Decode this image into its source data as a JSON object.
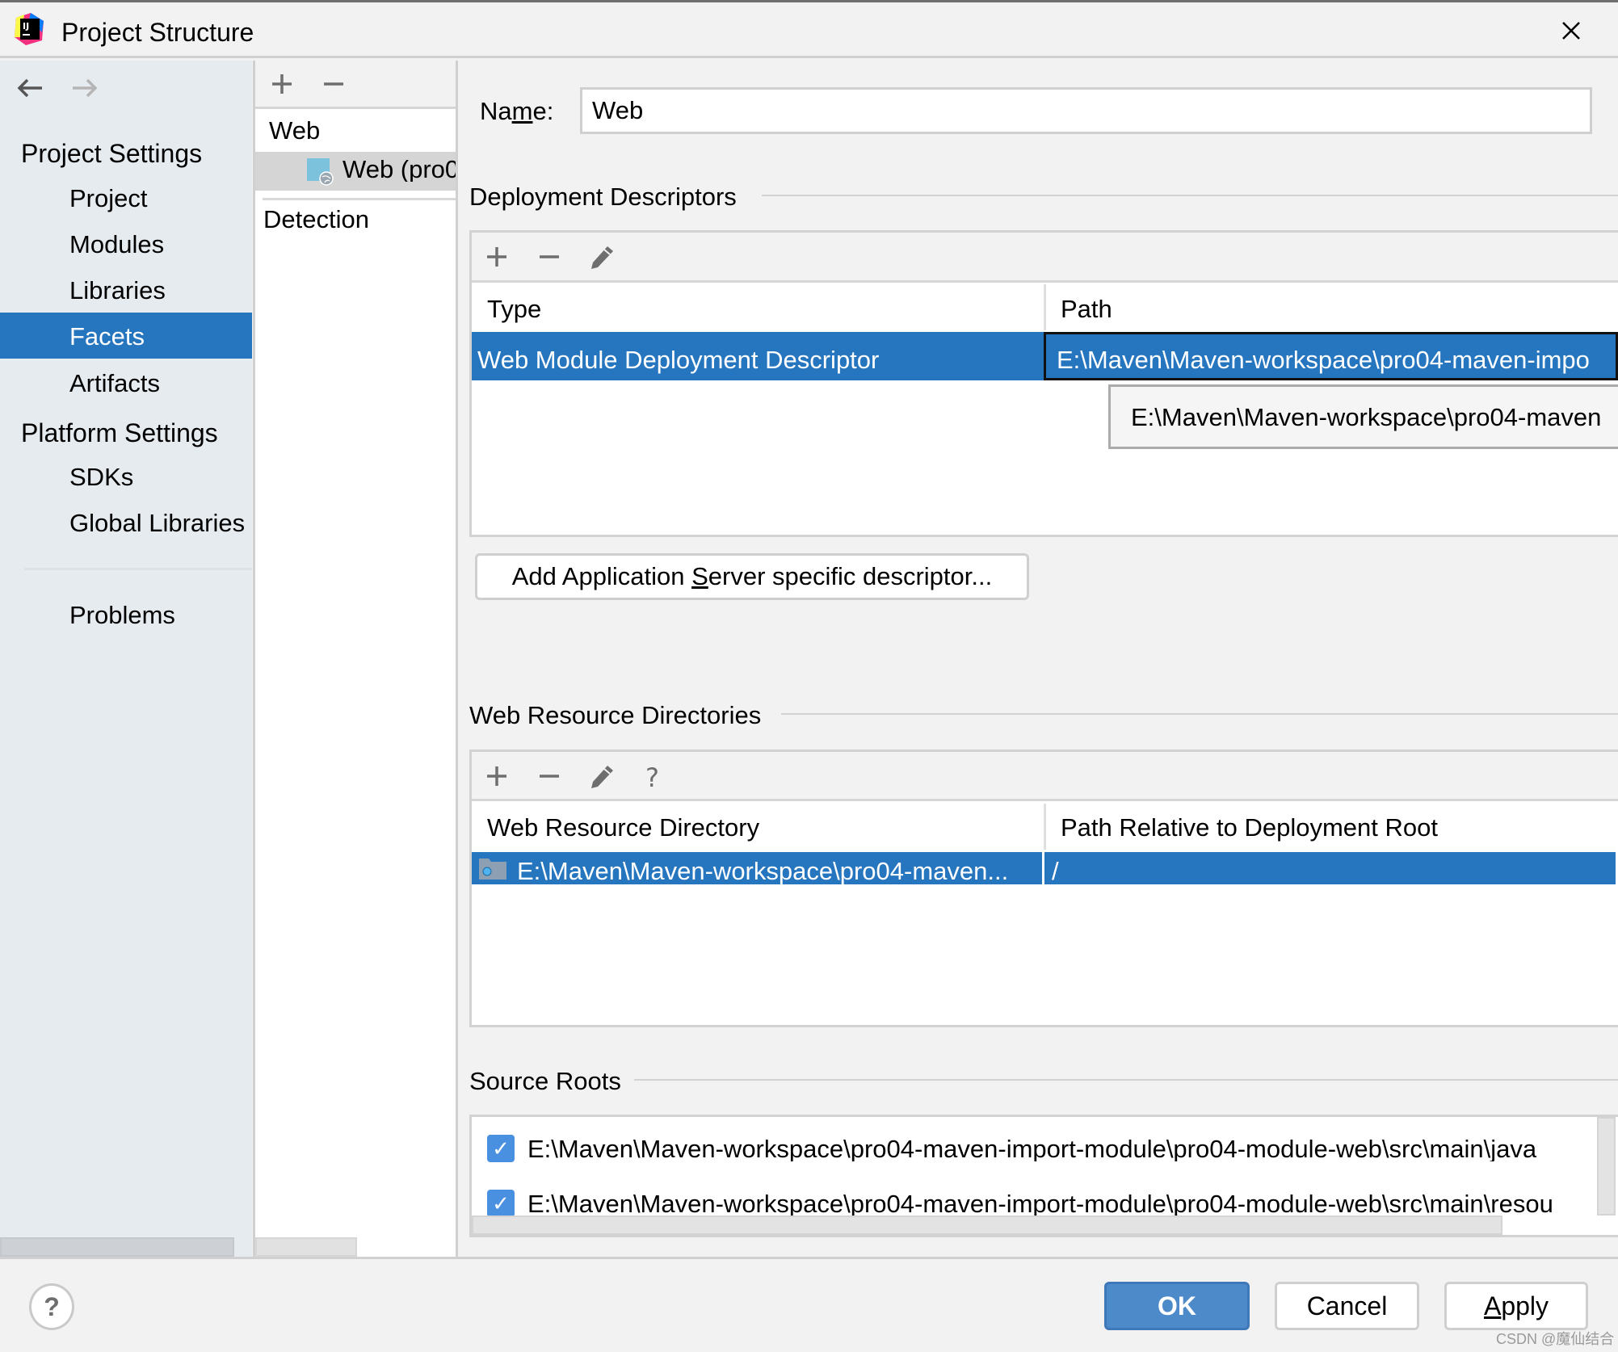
{
  "window": {
    "title": "Project Structure"
  },
  "nav": {
    "back_icon": "arrow-left-icon",
    "forward_icon": "arrow-right-icon"
  },
  "sidebar": {
    "project_settings_header": "Project Settings",
    "project_items": [
      {
        "label": "Project"
      },
      {
        "label": "Modules"
      },
      {
        "label": "Libraries"
      },
      {
        "label": "Facets",
        "selected": true
      },
      {
        "label": "Artifacts"
      }
    ],
    "platform_settings_header": "Platform Settings",
    "platform_items": [
      {
        "label": "SDKs"
      },
      {
        "label": "Global Libraries"
      }
    ],
    "problems": "Problems"
  },
  "facets_tree": {
    "group": "Web",
    "item": "Web (pro0",
    "detection": "Detection"
  },
  "facet": {
    "name_label_pre": "Na",
    "name_label_mnemonic": "m",
    "name_label_post": "e:",
    "name_value": "Web"
  },
  "deployment_descriptors": {
    "title": "Deployment Descriptors",
    "columns": [
      "Type",
      "Path"
    ],
    "rows": [
      {
        "type": "Web Module Deployment Descriptor",
        "path": "E:\\Maven\\Maven-workspace\\pro04-maven-impo"
      }
    ],
    "tooltip": "E:\\Maven\\Maven-workspace\\pro04-maven",
    "add_button_pre": "Add Application ",
    "add_button_mnemonic": "S",
    "add_button_post": "erver specific descriptor..."
  },
  "web_resources": {
    "title": "Web Resource Directories",
    "columns": [
      "Web Resource Directory",
      "Path Relative to Deployment Root"
    ],
    "rows": [
      {
        "directory": "E:\\Maven\\Maven-workspace\\pro04-maven...",
        "relative_path": "/"
      }
    ]
  },
  "source_roots": {
    "title": "Source Roots",
    "items": [
      {
        "checked": true,
        "path": "E:\\Maven\\Maven-workspace\\pro04-maven-import-module\\pro04-module-web\\src\\main\\java"
      },
      {
        "checked": true,
        "path": "E:\\Maven\\Maven-workspace\\pro04-maven-import-module\\pro04-module-web\\src\\main\\resou"
      }
    ]
  },
  "footer": {
    "help": "?",
    "ok": "OK",
    "cancel": "Cancel",
    "apply_mnemonic": "A",
    "apply_rest": "pply"
  },
  "watermark": "CSDN @魔仙结合",
  "colors": {
    "selection": "#2675bf",
    "sidebar_bg": "#e6ebf0",
    "ok_button": "#4d8aca"
  }
}
